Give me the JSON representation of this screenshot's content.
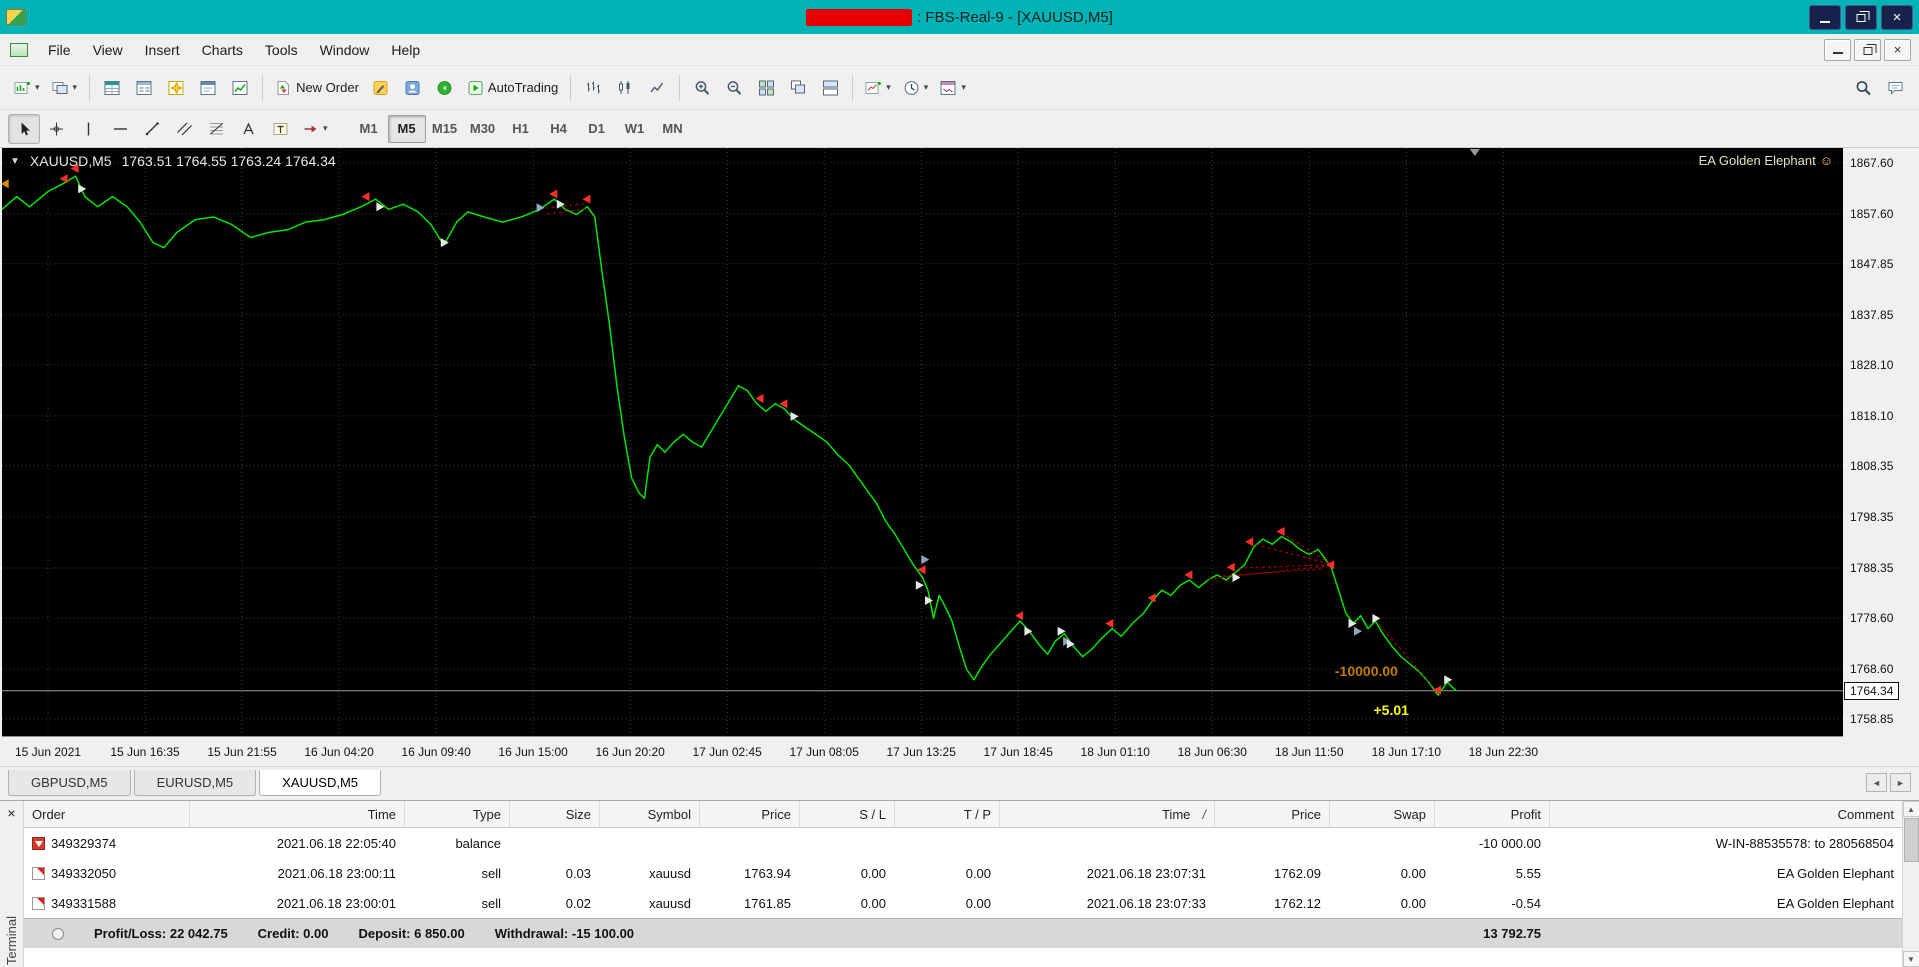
{
  "colors": {
    "titlebar": "#00b3b5",
    "window_bg": "#f0f0f0"
  },
  "titlebar": {
    "title": ": FBS-Real-9 - [XAUUSD,M5]"
  },
  "menus": [
    "File",
    "View",
    "Insert",
    "Charts",
    "Tools",
    "Window",
    "Help"
  ],
  "toolbar1": {
    "left": [
      {
        "name": "new-chart",
        "dropdown": true
      },
      {
        "name": "profiles",
        "dropdown": true
      },
      {
        "sep": true
      },
      {
        "name": "market-watch"
      },
      {
        "name": "data-window"
      },
      {
        "name": "navigator"
      },
      {
        "name": "terminal"
      },
      {
        "name": "strategy-tester"
      },
      {
        "sep": true
      },
      {
        "name": "new-order",
        "label": "New Order"
      },
      {
        "name": "metaeditor"
      },
      {
        "name": "experts"
      },
      {
        "name": "news"
      },
      {
        "name": "autotrading",
        "label": "AutoTrading"
      },
      {
        "sep": true
      },
      {
        "name": "bar-chart"
      },
      {
        "name": "candlestick-chart"
      },
      {
        "name": "line-chart"
      },
      {
        "sep": true
      },
      {
        "name": "zoom-in"
      },
      {
        "name": "zoom-out"
      },
      {
        "name": "tile-windows"
      },
      {
        "name": "cascade-windows"
      },
      {
        "name": "tile-horizontal"
      },
      {
        "sep": true
      },
      {
        "name": "indicators",
        "dropdown": true
      },
      {
        "name": "periods",
        "dropdown": true
      },
      {
        "name": "templates",
        "dropdown": true
      }
    ],
    "right": [
      {
        "name": "symbol-search"
      },
      {
        "name": "chat"
      }
    ]
  },
  "toolbar2": {
    "tools": [
      {
        "name": "cursor",
        "active": true
      },
      {
        "name": "crosshair"
      },
      {
        "name": "vertical-line"
      },
      {
        "name": "horizontal-line"
      },
      {
        "name": "trendline"
      },
      {
        "name": "equidistant-channel"
      },
      {
        "name": "fibonacci"
      },
      {
        "name": "text"
      },
      {
        "name": "text-label"
      },
      {
        "name": "arrows",
        "dropdown": true
      }
    ],
    "timeframes": [
      "M1",
      "M5",
      "M15",
      "M30",
      "H1",
      "H4",
      "D1",
      "W1",
      "MN"
    ],
    "active_timeframe": "M5"
  },
  "chart": {
    "symbol_period": "XAUUSD,M5",
    "ohlc": "1763.51 1764.55 1763.24 1764.34",
    "ea_label": "EA Golden Elephant",
    "ea_smiley": "☺"
  },
  "chart_data": {
    "type": "line",
    "symbol": "XAUUSD",
    "timeframe": "M5",
    "y_min": 1755.5,
    "y_max": 1870.5,
    "price_gridlines": [
      "1867.60",
      "1857.60",
      "1847.85",
      "1837.85",
      "1828.10",
      "1818.10",
      "1808.35",
      "1798.35",
      "1788.35",
      "1778.60",
      "1768.60",
      "1758.85"
    ],
    "current_price": "1764.34",
    "time_labels": [
      "15 Jun 2021",
      "15 Jun 16:35",
      "15 Jun 21:55",
      "16 Jun 04:20",
      "16 Jun 09:40",
      "16 Jun 15:00",
      "16 Jun 20:20",
      "17 Jun 02:45",
      "17 Jun 08:05",
      "17 Jun 13:25",
      "17 Jun 18:45",
      "18 Jun 01:10",
      "18 Jun 06:30",
      "18 Jun 11:50",
      "18 Jun 17:10",
      "18 Jun 22:30"
    ],
    "time_label_fracs": [
      0.025,
      0.0777,
      0.1304,
      0.1831,
      0.2358,
      0.2885,
      0.3412,
      0.3939,
      0.4466,
      0.4993,
      0.552,
      0.6047,
      0.6574,
      0.7101,
      0.7628,
      0.8155
    ],
    "line": [
      [
        0,
        1858.5
      ],
      [
        0.008,
        1861
      ],
      [
        0.015,
        1859
      ],
      [
        0.025,
        1862
      ],
      [
        0.033,
        1863.5
      ],
      [
        0.04,
        1865
      ],
      [
        0.045,
        1861
      ],
      [
        0.052,
        1859
      ],
      [
        0.06,
        1861
      ],
      [
        0.068,
        1859
      ],
      [
        0.075,
        1856
      ],
      [
        0.082,
        1852
      ],
      [
        0.088,
        1851
      ],
      [
        0.095,
        1854
      ],
      [
        0.105,
        1856.5
      ],
      [
        0.115,
        1857
      ],
      [
        0.125,
        1855.5
      ],
      [
        0.135,
        1853
      ],
      [
        0.145,
        1854
      ],
      [
        0.155,
        1854.5
      ],
      [
        0.165,
        1856
      ],
      [
        0.175,
        1856.5
      ],
      [
        0.185,
        1857.5
      ],
      [
        0.195,
        1859
      ],
      [
        0.203,
        1860.5
      ],
      [
        0.21,
        1858.5
      ],
      [
        0.218,
        1859.5
      ],
      [
        0.226,
        1858
      ],
      [
        0.233,
        1855.5
      ],
      [
        0.24,
        1851.5
      ],
      [
        0.247,
        1856
      ],
      [
        0.253,
        1858
      ],
      [
        0.262,
        1857
      ],
      [
        0.272,
        1856
      ],
      [
        0.282,
        1857
      ],
      [
        0.292,
        1858.5
      ],
      [
        0.3,
        1860.5
      ],
      [
        0.306,
        1858.5
      ],
      [
        0.312,
        1857.5
      ],
      [
        0.318,
        1859
      ],
      [
        0.322,
        1857
      ],
      [
        0.326,
        1846
      ],
      [
        0.33,
        1836
      ],
      [
        0.334,
        1824
      ],
      [
        0.338,
        1814
      ],
      [
        0.342,
        1806
      ],
      [
        0.346,
        1803
      ],
      [
        0.349,
        1802
      ],
      [
        0.352,
        1810
      ],
      [
        0.356,
        1812.5
      ],
      [
        0.36,
        1811
      ],
      [
        0.365,
        1813
      ],
      [
        0.37,
        1814.5
      ],
      [
        0.375,
        1813
      ],
      [
        0.38,
        1812
      ],
      [
        0.385,
        1815
      ],
      [
        0.39,
        1818
      ],
      [
        0.395,
        1821
      ],
      [
        0.4,
        1824
      ],
      [
        0.405,
        1823
      ],
      [
        0.41,
        1820.5
      ],
      [
        0.415,
        1819
      ],
      [
        0.42,
        1820.5
      ],
      [
        0.425,
        1819.5
      ],
      [
        0.43,
        1817.5
      ],
      [
        0.436,
        1816
      ],
      [
        0.442,
        1814.5
      ],
      [
        0.448,
        1813
      ],
      [
        0.454,
        1810.5
      ],
      [
        0.46,
        1808.5
      ],
      [
        0.465,
        1806
      ],
      [
        0.47,
        1803.5
      ],
      [
        0.475,
        1801
      ],
      [
        0.48,
        1797.5
      ],
      [
        0.485,
        1795
      ],
      [
        0.49,
        1792
      ],
      [
        0.495,
        1789
      ],
      [
        0.5,
        1786.5
      ],
      [
        0.503,
        1784
      ],
      [
        0.506,
        1778.5
      ],
      [
        0.509,
        1783
      ],
      [
        0.512,
        1781
      ],
      [
        0.516,
        1778
      ],
      [
        0.52,
        1773
      ],
      [
        0.524,
        1768.5
      ],
      [
        0.528,
        1766.5
      ],
      [
        0.532,
        1769
      ],
      [
        0.537,
        1771.5
      ],
      [
        0.542,
        1773.5
      ],
      [
        0.548,
        1776
      ],
      [
        0.553,
        1778
      ],
      [
        0.558,
        1776
      ],
      [
        0.563,
        1773.5
      ],
      [
        0.568,
        1771.5
      ],
      [
        0.572,
        1774
      ],
      [
        0.577,
        1775.5
      ],
      [
        0.582,
        1773
      ],
      [
        0.587,
        1771
      ],
      [
        0.592,
        1772.5
      ],
      [
        0.597,
        1774.5
      ],
      [
        0.603,
        1776.5
      ],
      [
        0.608,
        1775
      ],
      [
        0.614,
        1777.5
      ],
      [
        0.62,
        1779.5
      ],
      [
        0.625,
        1782
      ],
      [
        0.63,
        1784
      ],
      [
        0.635,
        1783
      ],
      [
        0.64,
        1785
      ],
      [
        0.645,
        1786
      ],
      [
        0.65,
        1784.5
      ],
      [
        0.655,
        1786
      ],
      [
        0.66,
        1787
      ],
      [
        0.665,
        1786
      ],
      [
        0.67,
        1787.5
      ],
      [
        0.675,
        1789
      ],
      [
        0.68,
        1792.5
      ],
      [
        0.685,
        1794
      ],
      [
        0.69,
        1793
      ],
      [
        0.695,
        1794.5
      ],
      [
        0.7,
        1793.5
      ],
      [
        0.705,
        1792
      ],
      [
        0.71,
        1791
      ],
      [
        0.715,
        1792
      ],
      [
        0.718,
        1790.5
      ],
      [
        0.722,
        1788.5
      ],
      [
        0.726,
        1784
      ],
      [
        0.73,
        1779.5
      ],
      [
        0.734,
        1777.5
      ],
      [
        0.738,
        1779
      ],
      [
        0.742,
        1776.5
      ],
      [
        0.746,
        1778
      ],
      [
        0.75,
        1775.5
      ],
      [
        0.755,
        1773
      ],
      [
        0.76,
        1771
      ],
      [
        0.765,
        1769.5
      ],
      [
        0.77,
        1768
      ],
      [
        0.775,
        1766
      ],
      [
        0.78,
        1763.5
      ],
      [
        0.785,
        1766
      ],
      [
        0.79,
        1764.3
      ]
    ],
    "markers": [
      {
        "x": 0.002,
        "p": 1863.5,
        "t": "flag"
      },
      {
        "x": 0.034,
        "p": 1864.5,
        "t": "sell"
      },
      {
        "x": 0.04,
        "p": 1866.5,
        "t": "sell"
      },
      {
        "x": 0.043,
        "p": 1862.5,
        "t": "buy"
      },
      {
        "x": 0.198,
        "p": 1861.0,
        "t": "sell"
      },
      {
        "x": 0.205,
        "p": 1859.0,
        "t": "buy"
      },
      {
        "x": 0.24,
        "p": 1852.0,
        "t": "buy"
      },
      {
        "x": 0.292,
        "p": 1858.8,
        "t": "close"
      },
      {
        "x": 0.3,
        "p": 1861.5,
        "t": "sell"
      },
      {
        "x": 0.303,
        "p": 1859.5,
        "t": "buy"
      },
      {
        "x": 0.318,
        "p": 1860.5,
        "t": "sell"
      },
      {
        "x": 0.412,
        "p": 1821.5,
        "t": "sell"
      },
      {
        "x": 0.425,
        "p": 1820.5,
        "t": "sell"
      },
      {
        "x": 0.43,
        "p": 1818.0,
        "t": "buy"
      },
      {
        "x": 0.498,
        "p": 1785.0,
        "t": "buy"
      },
      {
        "x": 0.5,
        "p": 1788.0,
        "t": "sell"
      },
      {
        "x": 0.501,
        "p": 1790.0,
        "t": "close"
      },
      {
        "x": 0.503,
        "p": 1782.0,
        "t": "buy"
      },
      {
        "x": 0.553,
        "p": 1779.0,
        "t": "sell"
      },
      {
        "x": 0.557,
        "p": 1776.0,
        "t": "buy"
      },
      {
        "x": 0.575,
        "p": 1776.0,
        "t": "buy"
      },
      {
        "x": 0.578,
        "p": 1774.0,
        "t": "close"
      },
      {
        "x": 0.58,
        "p": 1773.5,
        "t": "buy"
      },
      {
        "x": 0.602,
        "p": 1777.5,
        "t": "sell"
      },
      {
        "x": 0.625,
        "p": 1782.5,
        "t": "sell"
      },
      {
        "x": 0.645,
        "p": 1787.0,
        "t": "sell"
      },
      {
        "x": 0.668,
        "p": 1788.5,
        "t": "sell"
      },
      {
        "x": 0.67,
        "p": 1786.5,
        "t": "buy"
      },
      {
        "x": 0.678,
        "p": 1793.5,
        "t": "sell"
      },
      {
        "x": 0.695,
        "p": 1795.5,
        "t": "sell"
      },
      {
        "x": 0.722,
        "p": 1789.0,
        "t": "sell"
      },
      {
        "x": 0.733,
        "p": 1777.5,
        "t": "buy"
      },
      {
        "x": 0.736,
        "p": 1776.0,
        "t": "close"
      },
      {
        "x": 0.746,
        "p": 1778.5,
        "t": "buy"
      },
      {
        "x": 0.78,
        "p": 1764.5,
        "t": "sell"
      },
      {
        "x": 0.785,
        "p": 1766.5,
        "t": "buy"
      }
    ],
    "trade_lines": [
      [
        0.655,
        1786.2,
        0.721,
        1788.8
      ],
      [
        0.668,
        1788.3,
        0.721,
        1789.0
      ],
      [
        0.678,
        1793.2,
        0.721,
        1789.2
      ],
      [
        0.695,
        1795.2,
        0.721,
        1789.4
      ],
      [
        0.663,
        1786.8,
        0.718,
        1788.2
      ],
      [
        0.292,
        1858.6,
        0.317,
        1859.6
      ],
      [
        0.296,
        1857.6,
        0.317,
        1858.6
      ],
      [
        0.746,
        1778.2,
        0.779,
        1764.4
      ]
    ],
    "annotations": [
      {
        "x": 0.724,
        "p": 1767.2,
        "text": "-10000.00",
        "color": "#c07d00"
      },
      {
        "x": 0.745,
        "p": 1759.6,
        "text": "+5.01",
        "color": "#ffff00"
      }
    ],
    "shift_marker_frac": 0.8,
    "colors": {
      "background": "#000000",
      "grid": "#3a3a3a",
      "line": "#00e400",
      "sell": "#ff2d2d",
      "buy": "#e8e8e8",
      "close": "#8fa8b8",
      "flag": "#e08a00",
      "trade_line": "#bb0000",
      "current_price_line": "#8fa3a3"
    }
  },
  "chart_tabs": {
    "tabs": [
      "GBPUSD,M5",
      "EURUSD,M5",
      "XAUUSD,M5"
    ],
    "active_index": 2
  },
  "terminal": {
    "panel_title": "Terminal",
    "columns": [
      "Order",
      "Time",
      "Type",
      "Size",
      "Symbol",
      "Price",
      "S / L",
      "T / P",
      "Time",
      "Price",
      "Swap",
      "Profit",
      "Comment"
    ],
    "sort_indicator": "/",
    "rows": [
      {
        "icon": "balance",
        "cells": [
          "349329374",
          "2021.06.18 22:05:40",
          "balance",
          "",
          "",
          "",
          "",
          "",
          "",
          "",
          "",
          "-10 000.00",
          "W-IN-88535578: to 280568504"
        ]
      },
      {
        "icon": "closed-order",
        "cells": [
          "349332050",
          "2021.06.18 23:00:11",
          "sell",
          "0.03",
          "xauusd",
          "1763.94",
          "0.00",
          "0.00",
          "2021.06.18 23:07:31",
          "1762.09",
          "0.00",
          "5.55",
          "EA Golden Elephant"
        ]
      },
      {
        "icon": "closed-order",
        "cells": [
          "349331588",
          "2021.06.18 23:00:01",
          "sell",
          "0.02",
          "xauusd",
          "1761.85",
          "0.00",
          "0.00",
          "2021.06.18 23:07:33",
          "1762.12",
          "0.00",
          "-0.54",
          "EA Golden Elephant"
        ]
      }
    ],
    "summary": {
      "items": [
        "Profit/Loss: 22 042.75",
        "Credit: 0.00",
        "Deposit: 6 850.00",
        "Withdrawal: -15 100.00"
      ],
      "profit": "13 792.75"
    }
  }
}
